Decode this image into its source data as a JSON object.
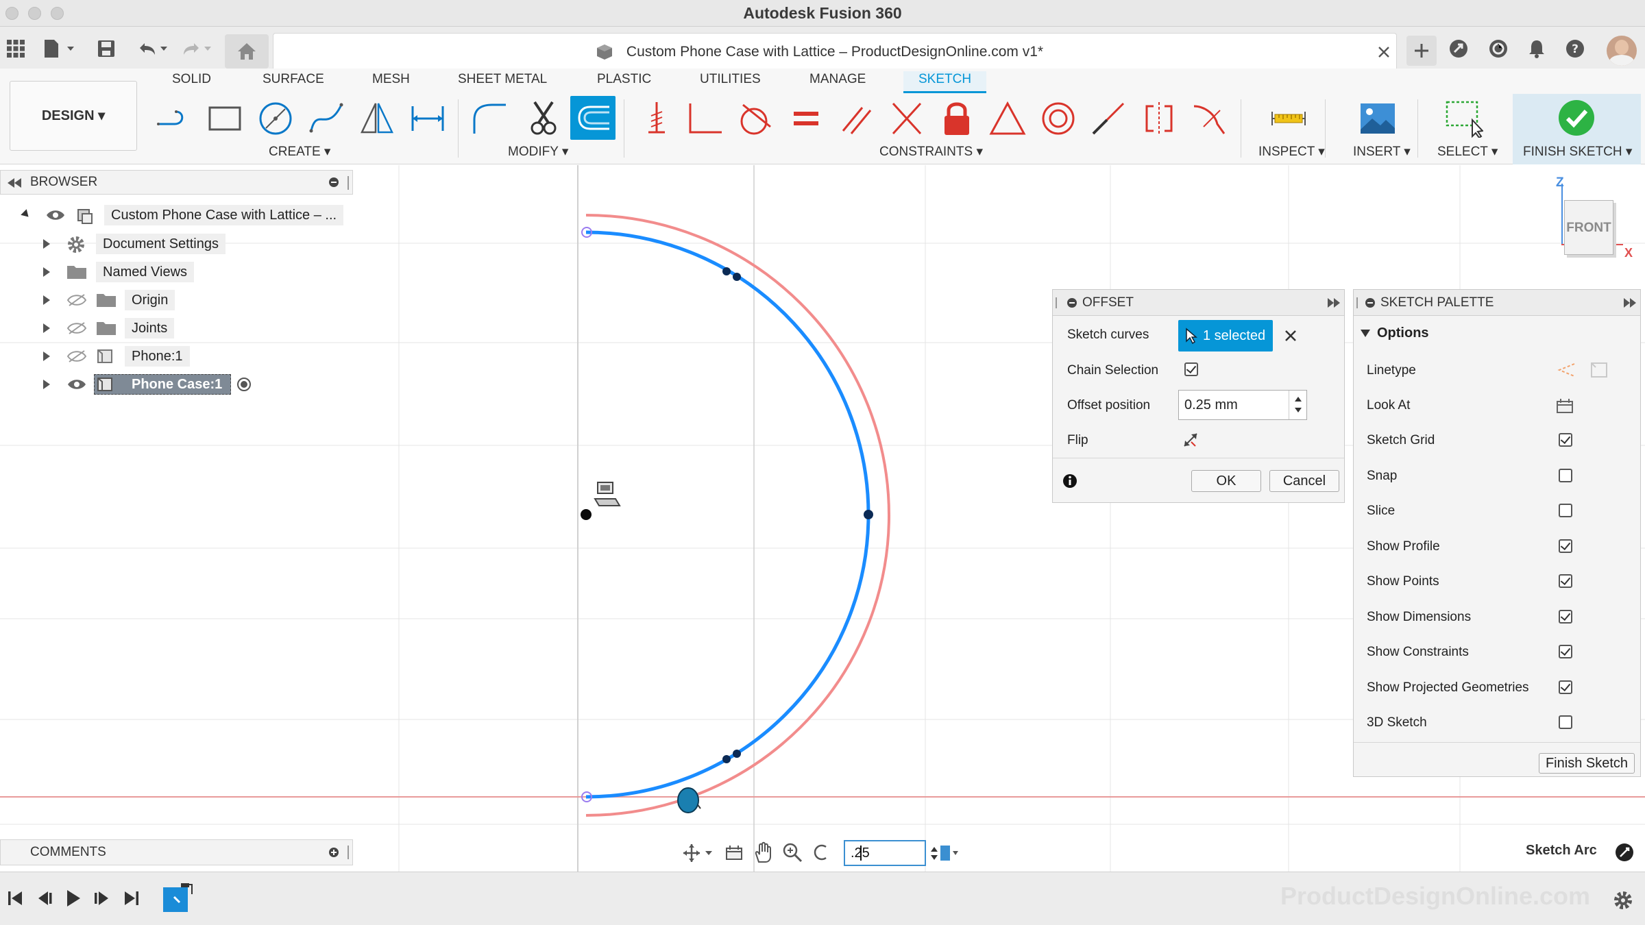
{
  "window": {
    "title": "Autodesk Fusion 360"
  },
  "document": {
    "title": "Custom Phone Case with Lattice – ProductDesignOnline.com v1*"
  },
  "ribbon": {
    "tabs": [
      "SOLID",
      "SURFACE",
      "MESH",
      "SHEET METAL",
      "PLASTIC",
      "UTILITIES",
      "MANAGE",
      "SKETCH"
    ],
    "active_tab": "SKETCH",
    "workspace": "DESIGN ▾",
    "groups": {
      "create": "CREATE ▾",
      "modify": "MODIFY ▾",
      "constraints": "CONSTRAINTS ▾",
      "inspect": "INSPECT ▾",
      "insert": "INSERT ▾",
      "select": "SELECT ▾",
      "finish": "FINISH SKETCH ▾"
    },
    "accent": "#0696d7"
  },
  "browser": {
    "title": "BROWSER",
    "root": "Custom Phone Case with Lattice – ...",
    "items": [
      {
        "label": "Document Settings",
        "icon": "gear-icon"
      },
      {
        "label": "Named Views",
        "icon": "folder-icon"
      },
      {
        "label": "Origin",
        "icon": "folder-icon"
      },
      {
        "label": "Joints",
        "icon": "folder-icon"
      },
      {
        "label": "Phone:1",
        "icon": "component-icon"
      },
      {
        "label": "Phone Case:1",
        "icon": "component-icon"
      }
    ]
  },
  "offset_dialog": {
    "title": "OFFSET",
    "sketch_curves_label": "Sketch curves",
    "selection": "1 selected",
    "chain_label": "Chain Selection",
    "chain_checked": true,
    "position_label": "Offset position",
    "position_value": "0.25 mm",
    "flip_label": "Flip",
    "ok": "OK",
    "cancel": "Cancel"
  },
  "sketch_palette": {
    "title": "SKETCH PALETTE",
    "section": "Options",
    "rows": [
      {
        "label": "Linetype",
        "type": "icons"
      },
      {
        "label": "Look At",
        "type": "icon"
      },
      {
        "label": "Sketch Grid",
        "type": "check",
        "checked": true
      },
      {
        "label": "Snap",
        "type": "check",
        "checked": false
      },
      {
        "label": "Slice",
        "type": "check",
        "checked": false
      },
      {
        "label": "Show Profile",
        "type": "check",
        "checked": true
      },
      {
        "label": "Show Points",
        "type": "check",
        "checked": true
      },
      {
        "label": "Show Dimensions",
        "type": "check",
        "checked": true
      },
      {
        "label": "Show Constraints",
        "type": "check",
        "checked": true
      },
      {
        "label": "Show Projected Geometries",
        "type": "check",
        "checked": true
      },
      {
        "label": "3D Sketch",
        "type": "check",
        "checked": false
      }
    ],
    "finish_button": "Finish Sketch"
  },
  "viewcube": {
    "face": "FRONT",
    "axis_z": "Z",
    "axis_x": "X"
  },
  "canvas": {
    "dimension_input": ".25",
    "status": "Sketch Arc"
  },
  "comments": {
    "title": "COMMENTS"
  },
  "watermark": "ProductDesignOnline.com"
}
